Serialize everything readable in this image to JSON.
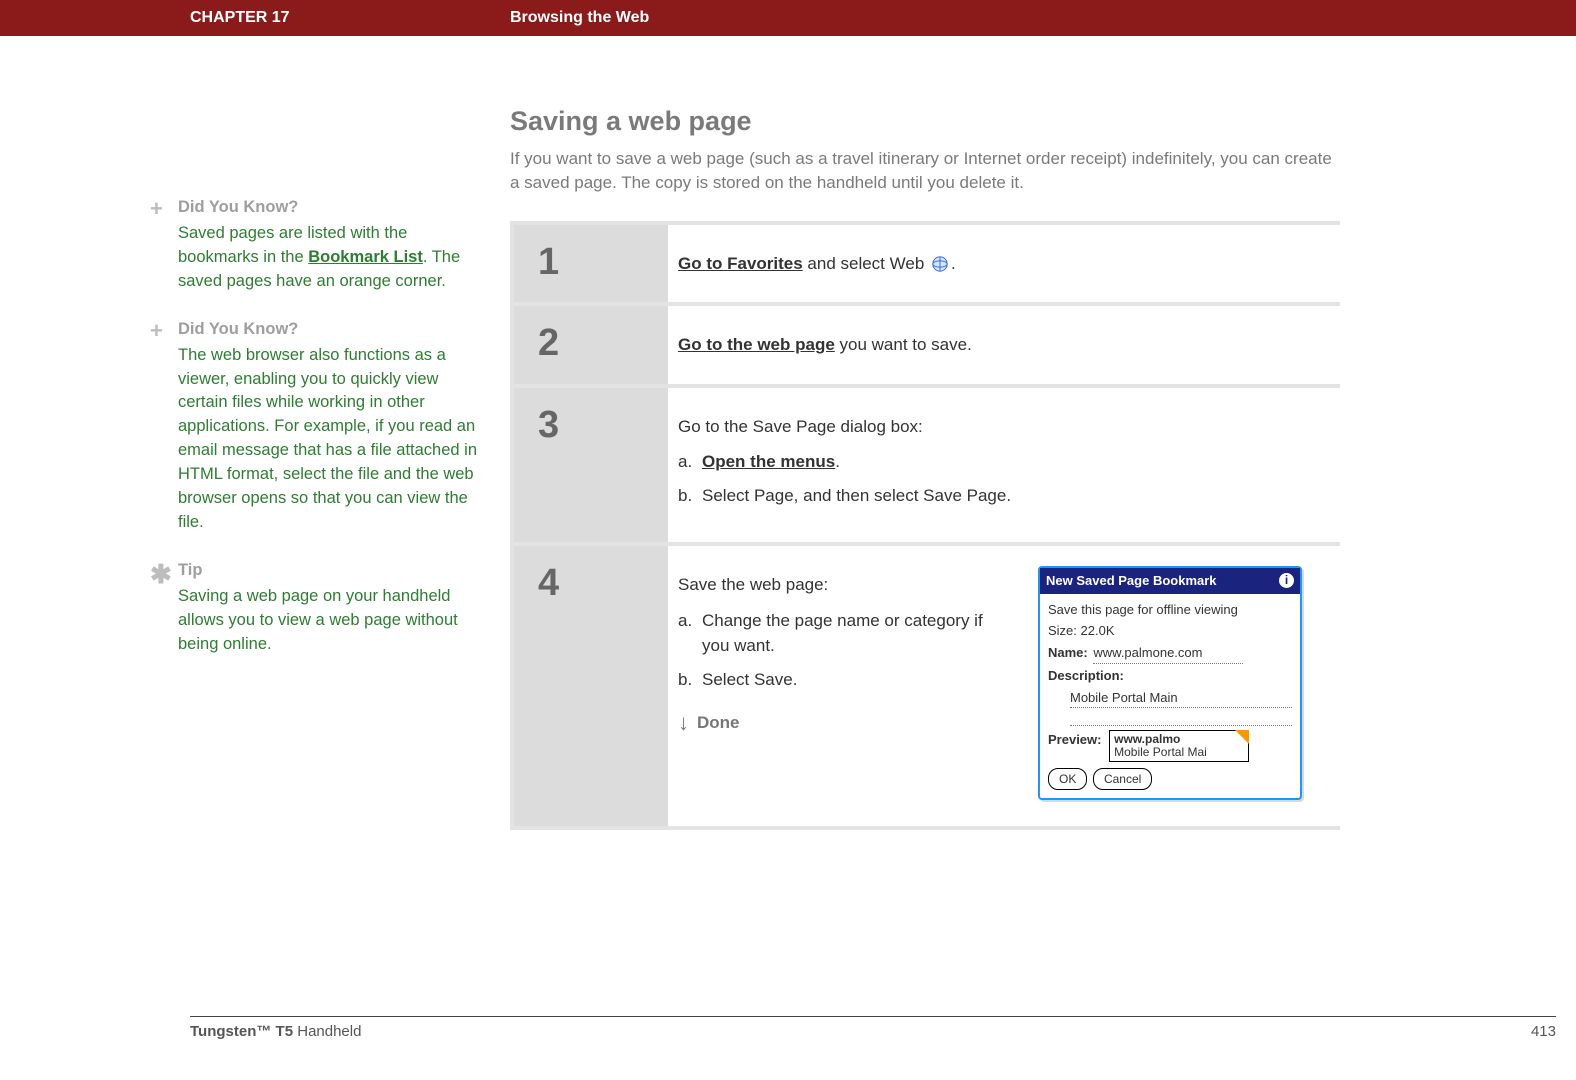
{
  "header": {
    "chapter": "CHAPTER 17",
    "title": "Browsing the Web"
  },
  "main": {
    "section_title": "Saving a web page",
    "intro": "If you want to save a web page (such as a travel itinerary or Internet order receipt) indefinitely, you can create a saved page. The copy is stored on the handheld until you delete it."
  },
  "sidebar": {
    "dyk1_title": "Did You Know?",
    "dyk1_pre": "Saved pages are listed with the bookmarks in the ",
    "dyk1_link": "Bookmark List",
    "dyk1_post": ". The saved pages have an orange corner.",
    "dyk2_title": "Did You Know?",
    "dyk2_text": "The web browser also functions as a viewer, enabling you to quickly view certain files while working in other applications. For example, if you read an email message that has a file attached in HTML format, select the file and the web browser opens so that you can view the file.",
    "tip_title": "Tip",
    "tip_text": "Saving a web page on your handheld allows you to view a web page without being online."
  },
  "steps": {
    "s1": {
      "num": "1",
      "link": "Go to Favorites",
      "rest": " and select Web ",
      "tail": "."
    },
    "s2": {
      "num": "2",
      "link": "Go to the web page",
      "rest": " you want to save."
    },
    "s3": {
      "num": "3",
      "lead": "Go to the Save Page dialog box:",
      "a_link": "Open the menus",
      "a_tail": ".",
      "b": "Select Page, and then select Save Page."
    },
    "s4": {
      "num": "4",
      "lead": "Save the web page:",
      "a": "Change the page name or category if you want.",
      "b": "Select Save.",
      "done": "Done"
    }
  },
  "dialog": {
    "title": "New Saved Page Bookmark",
    "line1": "Save this page for offline viewing",
    "size_label": "Size:",
    "size_value": "22.0K",
    "name_label": "Name:",
    "name_value": "www.palmone.com",
    "desc_label": "Description:",
    "desc_value": "Mobile Portal Main",
    "preview_label": "Preview:",
    "preview_line1": "www.palmo",
    "preview_line2": "Mobile Portal Mai",
    "ok": "OK",
    "cancel": "Cancel"
  },
  "footer": {
    "product_bold": "Tungsten™ T5",
    "product_rest": " Handheld",
    "page": "413"
  }
}
